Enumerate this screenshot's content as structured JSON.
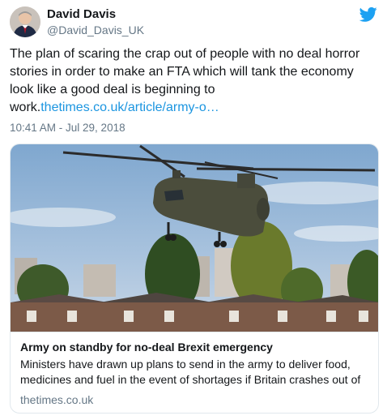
{
  "author": {
    "name": "David Davis",
    "handle": "@David_Davis_UK"
  },
  "tweet": {
    "text": "The plan of scaring the crap out of people with no deal horror stories in order to make an FTA which will tank the economy look like a good deal is beginning to work.",
    "link": "thetimes.co.uk/article/army-o…",
    "timestamp": "10:41 AM - Jul 29, 2018"
  },
  "card": {
    "image_description_icon": "chinook-helicopter-photo",
    "title": "Army on standby for no-deal Brexit emergency",
    "description": "Ministers have drawn up plans to send in the army to deliver food, medicines and fuel in the event of shortages if Britain crashes out of",
    "domain": "thetimes.co.uk"
  },
  "colors": {
    "link": "#1b95e0",
    "twitter_blue": "#1da1f2",
    "secondary_text": "#657786",
    "border": "#e1e8ed"
  }
}
